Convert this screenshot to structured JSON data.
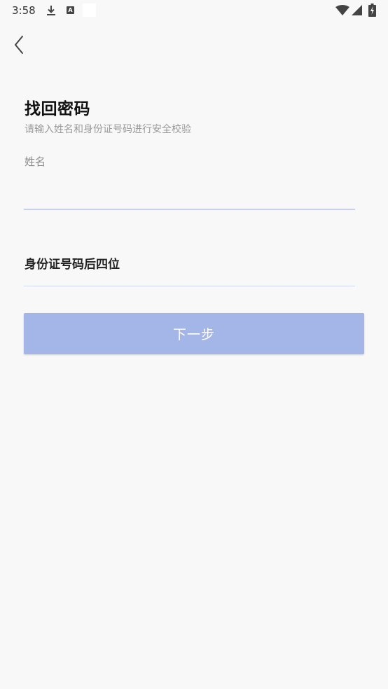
{
  "status_bar": {
    "time": "3:58",
    "download_icon": "download-icon",
    "a_badge": "A",
    "wifi_icon": "wifi-icon",
    "signal_icon": "signal-icon",
    "battery_icon": "battery-charging-icon"
  },
  "nav": {
    "back_icon": "chevron-left-icon"
  },
  "header": {
    "title": "找回密码",
    "subtitle": "请输入姓名和身份证号码进行安全校验"
  },
  "form": {
    "name_label": "姓名",
    "name_value": "",
    "id_placeholder": "身份证号码后四位",
    "id_value": ""
  },
  "actions": {
    "next_label": "下一步"
  },
  "colors": {
    "background": "#f8f8f8",
    "button": "#a4b5e8",
    "underline": "#c9d0ec",
    "subtitle": "#9a9a9a"
  }
}
